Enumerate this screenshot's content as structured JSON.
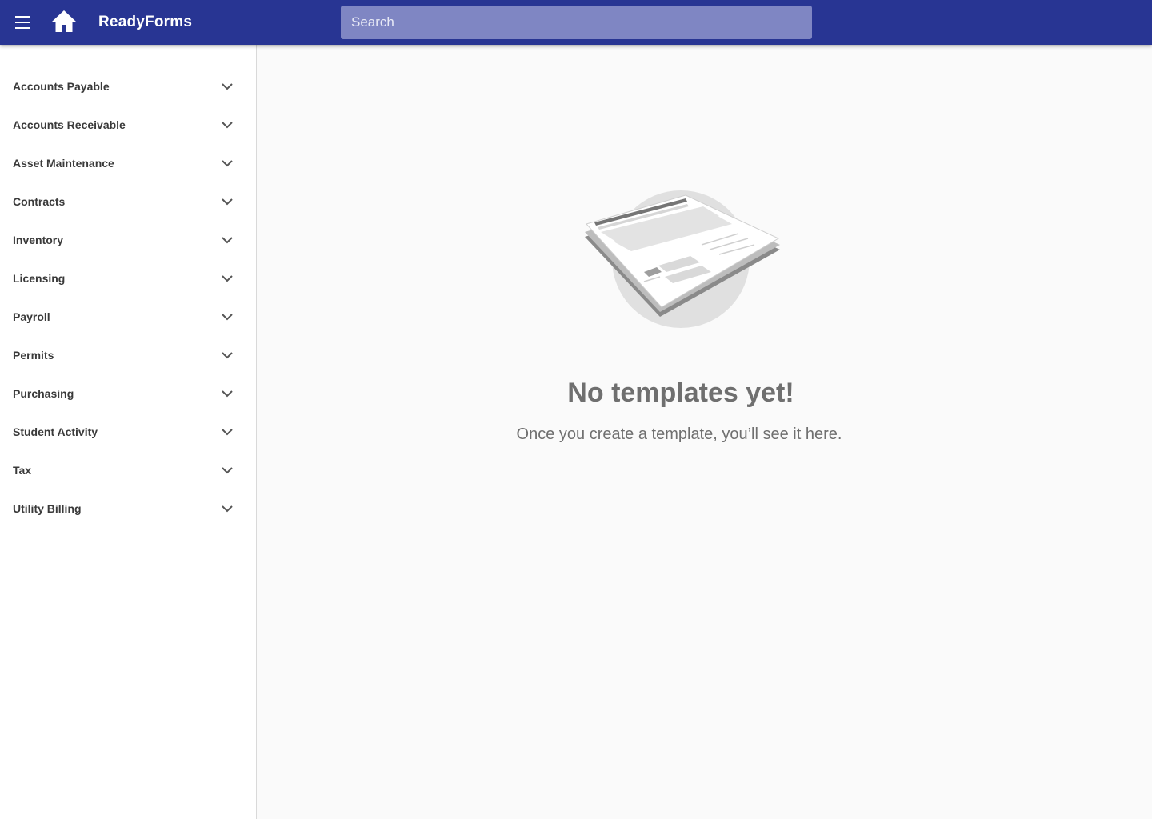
{
  "header": {
    "menu_icon": "hamburger-menu-icon",
    "home_icon": "home-icon",
    "app_title": "ReadyForms",
    "search_placeholder": "Search",
    "background_color": "#283593"
  },
  "sidebar": {
    "items": [
      {
        "label": "Accounts Payable"
      },
      {
        "label": "Accounts Receivable"
      },
      {
        "label": "Asset Maintenance"
      },
      {
        "label": "Contracts"
      },
      {
        "label": "Inventory"
      },
      {
        "label": "Licensing"
      },
      {
        "label": "Payroll"
      },
      {
        "label": "Permits"
      },
      {
        "label": "Purchasing"
      },
      {
        "label": "Student Activity"
      },
      {
        "label": "Tax"
      },
      {
        "label": "Utility Billing"
      }
    ],
    "expand_icon": "chevron-down-icon"
  },
  "main": {
    "illustration": "empty-document-illustration",
    "empty_title": "No templates yet!",
    "empty_subtitle": "Once you create a template, you’ll see it here."
  }
}
